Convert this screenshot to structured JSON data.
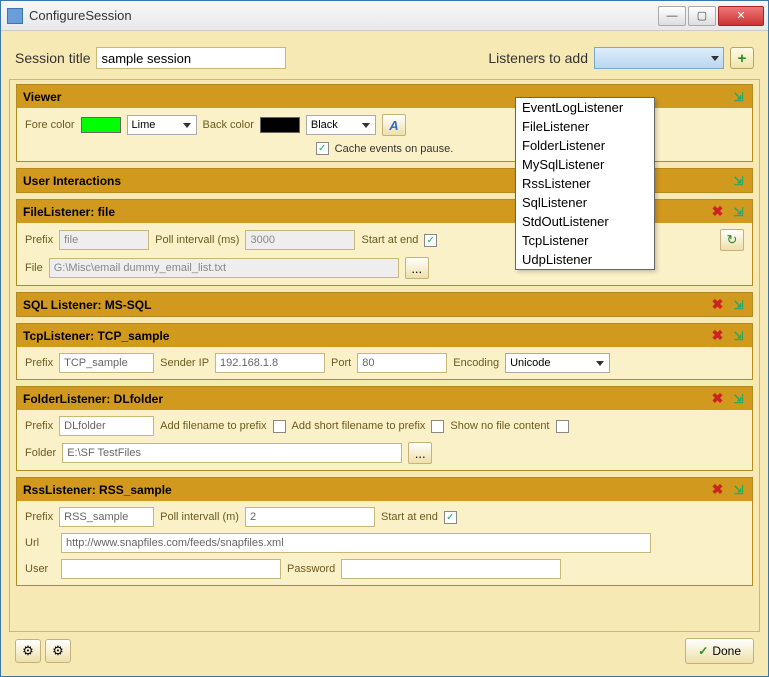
{
  "window": {
    "title": "ConfigureSession"
  },
  "top": {
    "session_title_label": "Session title",
    "session_title_value": "sample session",
    "listeners_label": "Listeners to add",
    "dropdown_items": [
      "EventLogListener",
      "FileListener",
      "FolderListener",
      "MySqlListener",
      "RssListener",
      "SqlListener",
      "StdOutListener",
      "TcpListener",
      "UdpListener"
    ]
  },
  "viewer": {
    "header": "Viewer",
    "forecolor_label": "Fore color",
    "forecolor_value": "Lime",
    "backcolor_label": "Back color",
    "backcolor_value": "Black",
    "cache_label": "Cache events on pause."
  },
  "useri": {
    "header": "User Interactions"
  },
  "file": {
    "header": "FileListener: file",
    "prefix_label": "Prefix",
    "prefix_value": "file",
    "poll_label": "Poll intervall (ms)",
    "poll_value": "3000",
    "start_label": "Start at end",
    "file_label": "File",
    "file_value": "G:\\Misc\\email dummy_email_list.txt",
    "browse": "..."
  },
  "sql": {
    "header": "SQL Listener: MS-SQL"
  },
  "tcp": {
    "header": "TcpListener: TCP_sample",
    "prefix_label": "Prefix",
    "prefix_value": "TCP_sample",
    "sender_label": "Sender IP",
    "sender_value": "192.168.1.8",
    "port_label": "Port",
    "port_value": "80",
    "enc_label": "Encoding",
    "enc_value": "Unicode"
  },
  "folder": {
    "header": "FolderListener: DLfolder",
    "prefix_label": "Prefix",
    "prefix_value": "DLfolder",
    "addfn_label": "Add filename to prefix",
    "addsfn_label": "Add short filename to prefix",
    "noshow_label": "Show no file content",
    "folder_label": "Folder",
    "folder_value": "E:\\SF TestFiles",
    "browse": "..."
  },
  "rss": {
    "header": "RssListener: RSS_sample",
    "prefix_label": "Prefix",
    "prefix_value": "RSS_sample",
    "poll_label": "Poll intervall (m)",
    "poll_value": "2",
    "start_label": "Start at end",
    "url_label": "Url",
    "url_value": "http://www.snapfiles.com/feeds/snapfiles.xml",
    "user_label": "User",
    "pwd_label": "Password"
  },
  "footer": {
    "done": "Done"
  }
}
